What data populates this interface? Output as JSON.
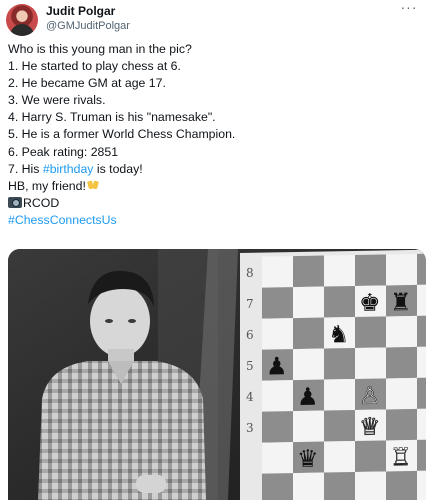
{
  "author": {
    "display_name": "Judit Polgar",
    "handle": "@GMJuditPolgar",
    "avatar_icon": "profile-avatar"
  },
  "menu_icon": "more-options-icon",
  "tweet": {
    "lines": [
      "Who is this young man in the pic?",
      "1. He started to play chess at 6.",
      "2. He became GM at age 17.",
      "3. We were rivals.",
      "4. Harry S. Truman is his \"namesake\".",
      "5. He is a former World Chess Champion.",
      "6. Peak rating: 2851"
    ],
    "line8_pre": "7. His ",
    "line8_hashtag": "#birthday",
    "line8_post": " is today!",
    "line9": "HB, my friend!",
    "line10": "RCOD",
    "hashtag_final": "#ChessConnectsUs"
  },
  "colors": {
    "link": "#1d9bf0",
    "text": "#0f1419",
    "secondary": "#536471"
  },
  "photo": {
    "description_icon": "chess-photo",
    "board_rank_labels": [
      "8",
      "7",
      "6",
      "5",
      "4",
      "3"
    ]
  }
}
